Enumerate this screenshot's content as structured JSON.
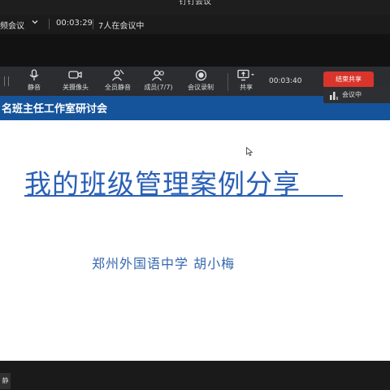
{
  "app": {
    "title": "钉钉会议"
  },
  "topbar": {
    "meeting_label": "频会议",
    "timer": "00:03:29",
    "participants": "7人在会议中"
  },
  "toolbar": {
    "items": [
      {
        "label": "静音",
        "icon": "microphone-icon"
      },
      {
        "label": "关摄像头",
        "icon": "camera-icon"
      },
      {
        "label": "全员静音",
        "icon": "mute-all-icon"
      },
      {
        "label": "成员(7/7)",
        "icon": "members-icon"
      },
      {
        "label": "会议录制",
        "icon": "record-icon"
      },
      {
        "label": "共享",
        "icon": "share-screen-icon"
      }
    ],
    "timer": "00:03:40",
    "end_share_label": "结束共享"
  },
  "badge": {
    "label": "会议中"
  },
  "slide": {
    "header_title": "名班主任工作室研讨会",
    "main_title": "我的班级管理案例分享",
    "author": "郑州外国语中学  胡小梅"
  },
  "bottombar": {
    "tag": "静"
  },
  "colors": {
    "header_blue": "#15549b",
    "title_blue": "#2960b8",
    "end_red": "#d9352c"
  }
}
